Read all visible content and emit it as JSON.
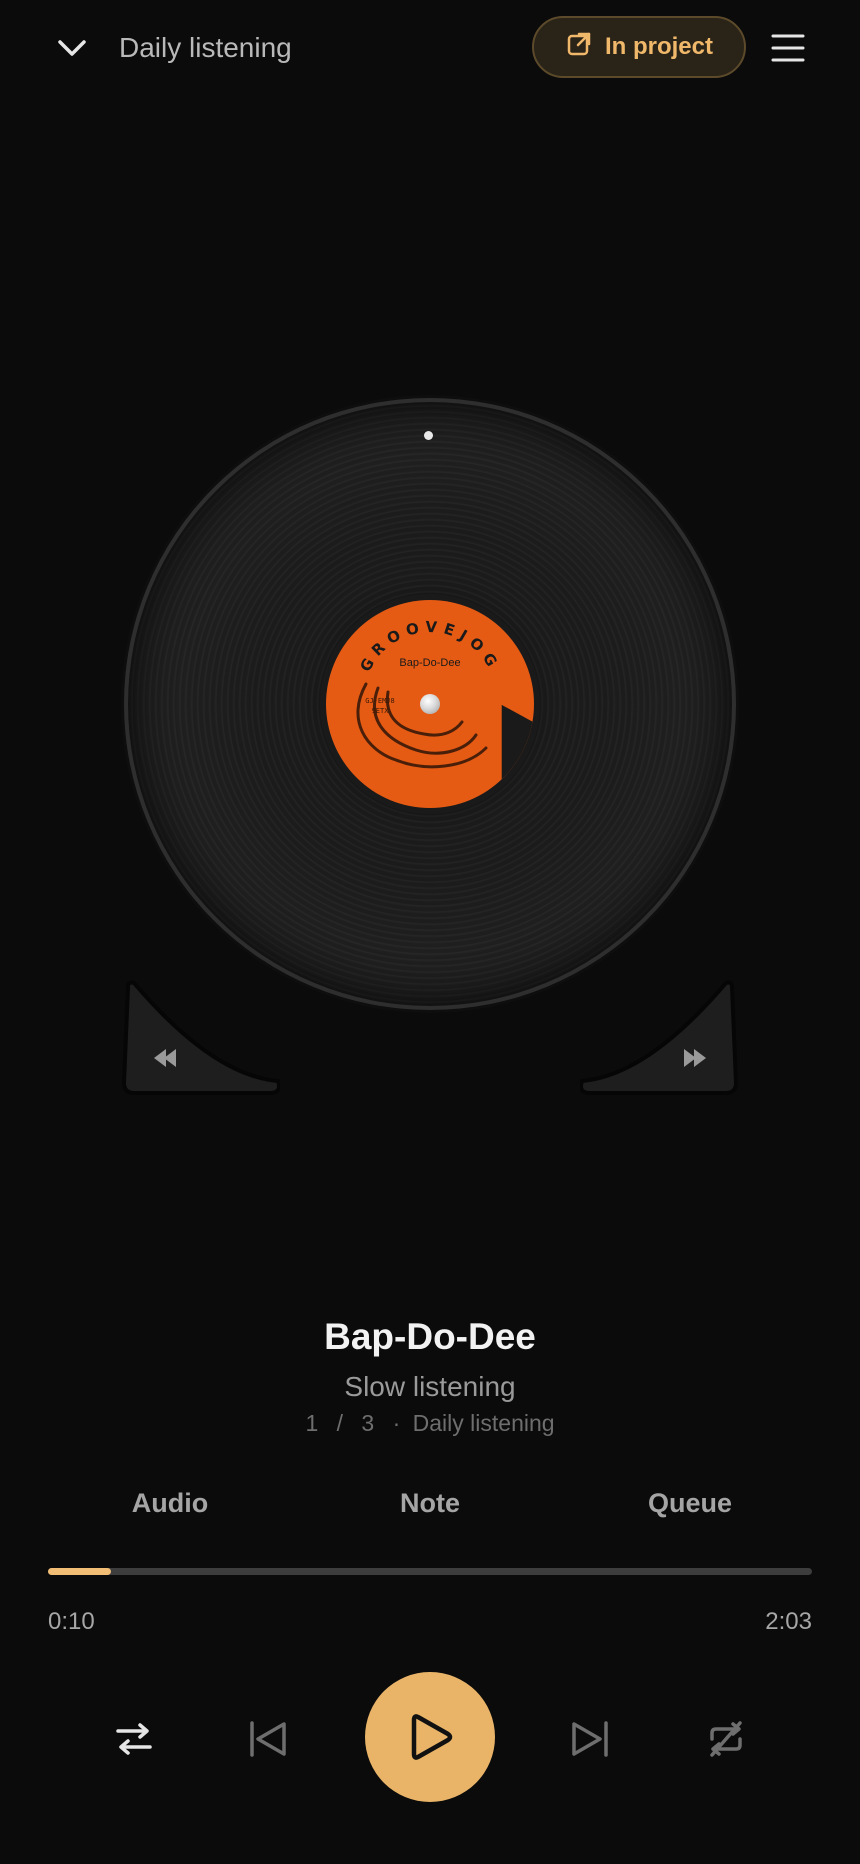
{
  "header": {
    "back_icon": "chevron-down-icon",
    "title": "Daily listening",
    "project_button_label": "In project",
    "project_button_icon": "external-link-icon",
    "menu_icon": "hamburger-menu-icon",
    "accent_color": "#f0b86a"
  },
  "record": {
    "label_brand": "GROOVEJOG",
    "label_title": "Bap-Do-Dee",
    "label_code_line1": "GJ-EMJ8",
    "label_code_line2": "9ETX",
    "label_color": "#e55b14"
  },
  "pads": {
    "left_icon": "rewind-icon",
    "right_icon": "fast-forward-icon"
  },
  "track": {
    "title": "Bap-Do-Dee",
    "subtitle": "Slow listening",
    "position": "1",
    "separator": "/",
    "total": "3",
    "dot": "·",
    "playlist": "Daily listening"
  },
  "tabs": [
    "Audio",
    "Note",
    "Queue"
  ],
  "progress": {
    "fraction": 0.082,
    "current": "0:10",
    "total": "2:03"
  },
  "controls": {
    "shuffle_icon": "shuffle-icon",
    "previous_icon": "skip-previous-icon",
    "play_icon": "play-icon",
    "next_icon": "skip-next-icon",
    "repeat_off_icon": "repeat-off-icon",
    "play_color": "#e9b468"
  }
}
